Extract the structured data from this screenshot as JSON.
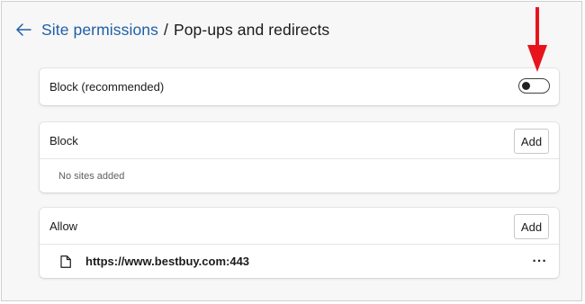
{
  "header": {
    "back_icon": "back-arrow-icon",
    "breadcrumb_parent": "Site permissions",
    "breadcrumb_separator": "/",
    "breadcrumb_current": "Pop-ups and redirects"
  },
  "block_toggle": {
    "label": "Block (recommended)",
    "enabled": false
  },
  "block_list": {
    "title": "Block",
    "add_label": "Add",
    "empty_text": "No sites added"
  },
  "allow_list": {
    "title": "Allow",
    "add_label": "Add",
    "items": [
      {
        "icon": "file-icon",
        "url": "https://www.bestbuy.com:443",
        "more": "···"
      }
    ]
  },
  "colors": {
    "link": "#1f5fa5",
    "annotation_arrow": "#e8141c",
    "background": "#f7f7f7"
  }
}
